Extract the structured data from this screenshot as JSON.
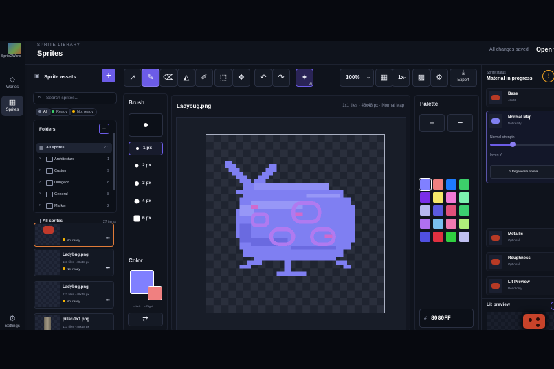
{
  "app": {
    "logo_text": "Sprite2World"
  },
  "rail": {
    "worlds_label": "Worlds",
    "sprites_label": "Sprites",
    "settings_label": "Settings"
  },
  "header": {
    "overline": "SPRITE LIBRARY",
    "title": "Sprites",
    "saved_status": "All changes saved",
    "open_label": "Open w"
  },
  "assets": {
    "title": "Sprite assets",
    "search_placeholder": "Search sprites...",
    "filters": [
      {
        "label": "All",
        "color": "#8c93a8"
      },
      {
        "label": "Ready",
        "color": "#3ccf6a"
      },
      {
        "label": "Not ready",
        "color": "#f5b301"
      }
    ],
    "folders_title": "Folders",
    "folders": [
      {
        "name": "All sprites",
        "count": "27"
      },
      {
        "name": "Architecture",
        "count": "1"
      },
      {
        "name": "Custom",
        "count": "9"
      },
      {
        "name": "Dungeon",
        "count": "8"
      },
      {
        "name": "General",
        "count": "8"
      },
      {
        "name": "Marker",
        "count": "2"
      }
    ],
    "list_title": "All sprites",
    "list_count": "27 items",
    "cards": [
      {
        "name": "",
        "meta": "1x1 tiles · 48x48 px",
        "status": "Not ready"
      },
      {
        "name": "Ladybug.png",
        "meta": "1x1 tiles · 48x48 px",
        "status": "Not ready"
      },
      {
        "name": "Ladybug.png",
        "meta": "1x1 tiles · 48x48 px",
        "status": "Not ready"
      },
      {
        "name": "pillar-1x1.png",
        "meta": "1x1 tiles · 48x48 px",
        "status": ""
      }
    ]
  },
  "toolbar": {
    "zoom": "100%",
    "scale": "1x",
    "export_label": "Export",
    "ai_badge": "AI"
  },
  "brush": {
    "title": "Brush",
    "sizes": [
      "1 px",
      "2 px",
      "3 px",
      "4 px",
      "6 px"
    ],
    "color_title": "Color",
    "left_label": "Left",
    "right_label": "Right",
    "primary_color": "#8080ff",
    "secondary_color": "#f08080"
  },
  "canvas": {
    "filename": "Ladybug.png",
    "info": "1x1 tiles · 48x48 px · Normal Map"
  },
  "palette": {
    "title": "Palette",
    "hex_value": "8080FF",
    "colors": [
      "#8080ff",
      "#f08080",
      "#1e7bff",
      "#3ccf6a",
      "#7a2ee8",
      "#f5e96a",
      "#f07ad6",
      "#7cf0b0",
      "#b8b8f0",
      "#5a5ae0",
      "#e0507a",
      "#3cd070",
      "#b070f0",
      "#7ac0f0",
      "#f07ab0",
      "#b0f07a",
      "#5050e0",
      "#e03040",
      "#30d040",
      "#c0c0f0"
    ]
  },
  "right": {
    "overline": "Sprite status",
    "material_status": "Material in progress",
    "maps": [
      {
        "name": "Base",
        "sub": "48x48"
      },
      {
        "name": "Normal Map",
        "sub": "Not ready"
      },
      {
        "name": "Metallic",
        "sub": "Optional"
      },
      {
        "name": "Roughness",
        "sub": "Optional"
      },
      {
        "name": "Lit Preview",
        "sub": "Read-only"
      }
    ],
    "normal_strength_label": "Normal strength",
    "normal_strength_value": 0.35,
    "invert_label": "Invert Y",
    "regenerate_label": "Regenerate normal",
    "lit_preview_title": "Lit preview"
  }
}
